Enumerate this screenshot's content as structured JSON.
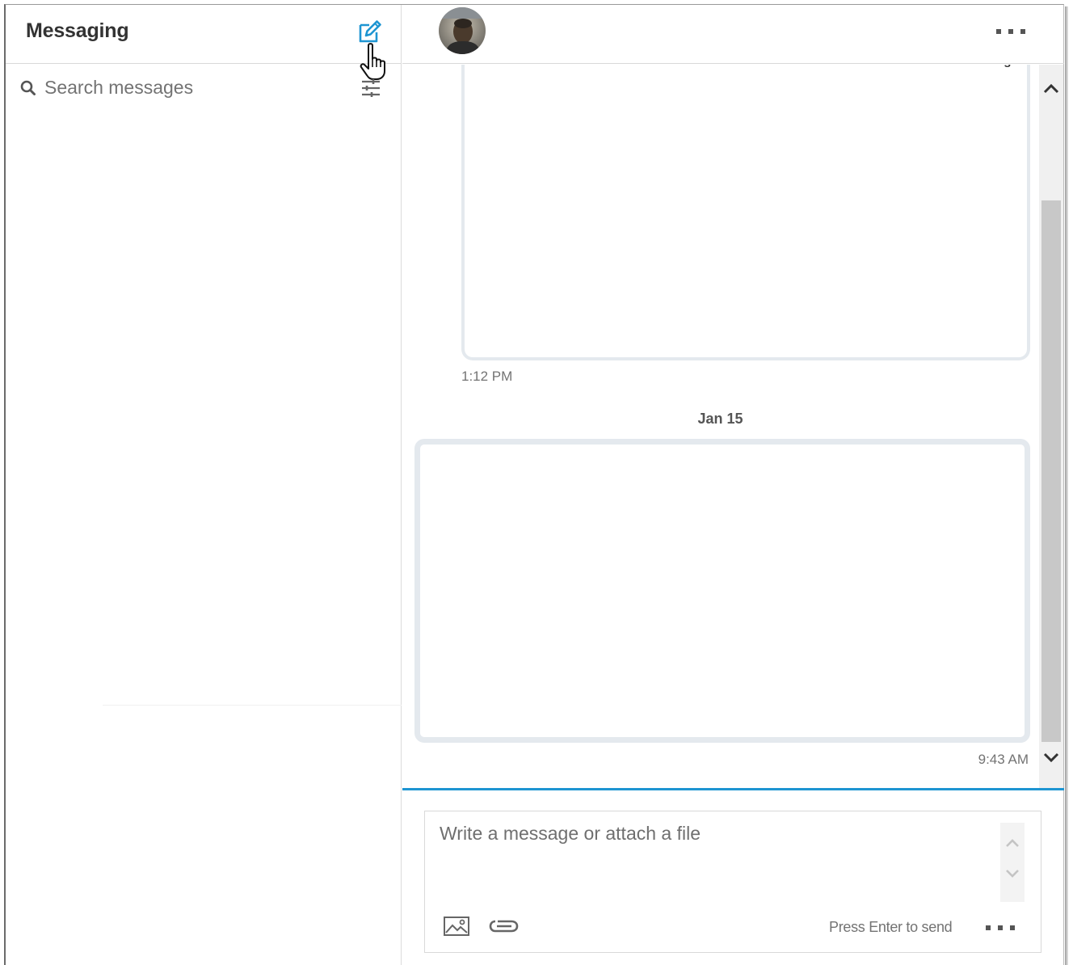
{
  "sidebar": {
    "title": "Messaging",
    "compose_icon": "compose-icon",
    "search": {
      "placeholder": "Search messages",
      "value": ""
    },
    "filter_icon": "filter-icon"
  },
  "conversation": {
    "header": {
      "avatar": "avatar",
      "more_icon": "more-icon"
    },
    "messages": [
      {
        "text": "s",
        "time": "1:12 PM"
      },
      {
        "text": "",
        "time": "9:43 AM"
      }
    ],
    "date_separator": "Jan 15"
  },
  "composer": {
    "placeholder": "Write a message or attach a file",
    "value": "",
    "hint": "Press Enter to send",
    "icons": [
      "image-icon",
      "attachment-icon",
      "more-icon"
    ]
  },
  "colors": {
    "accent": "#1e95d2",
    "bubble_border": "#e4e9ee",
    "scroll_thumb": "#c8c8c8"
  }
}
